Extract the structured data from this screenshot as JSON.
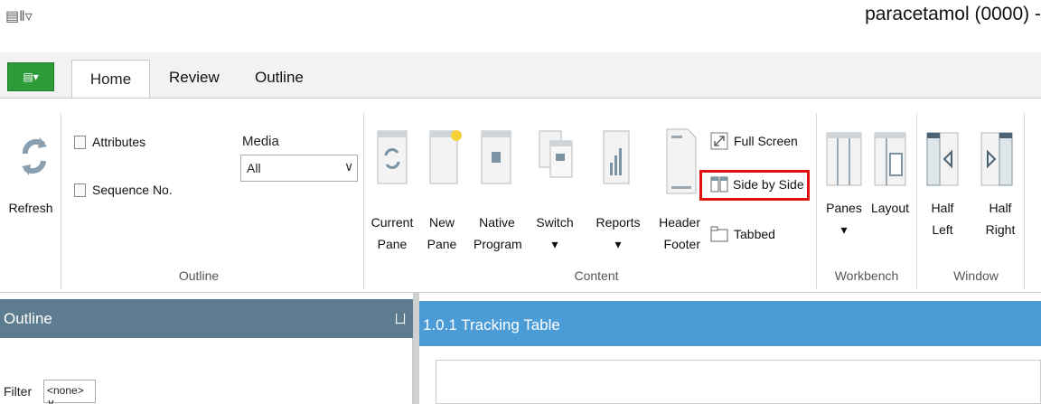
{
  "app": {
    "quick_access": "▤‖▿",
    "title": "paracetamol (0000) -"
  },
  "tabs": {
    "file_icon": "▤▾",
    "items": [
      "Home",
      "Review",
      "Outline"
    ],
    "active": "Home"
  },
  "ribbon": {
    "outline_group": {
      "label": "Outline",
      "refresh_label": "Refresh",
      "attributes_label": "Attributes",
      "sequence_label": "Sequence No.",
      "media_label": "Media",
      "media_value": "All"
    },
    "content_group": {
      "label": "Content",
      "current_pane": [
        "Current",
        "Pane"
      ],
      "new_pane": [
        "New",
        "Pane"
      ],
      "native_program": [
        "Native",
        "Program"
      ],
      "switch": [
        "Switch",
        "▾"
      ],
      "reports": [
        "Reports",
        "▾"
      ],
      "header_footer": [
        "Header",
        "Footer"
      ],
      "full_screen": "Full Screen",
      "side_by_side": "Side by Side",
      "tabbed": "Tabbed"
    },
    "workbench_group": {
      "label": "Workbench",
      "panes": [
        "Panes",
        "▾"
      ],
      "layout": "Layout"
    },
    "window_group": {
      "label": "Window",
      "half_left": [
        "Half",
        "Left"
      ],
      "half_right": [
        "Half",
        "Right"
      ]
    }
  },
  "outline_panel": {
    "title": "Outline",
    "pin": "ㄩ",
    "filter_label": "Filter",
    "filter_value": "<none> ∨"
  },
  "document_panel": {
    "title": "1.0.1 Tracking Table"
  },
  "colors": {
    "accent": "#4a9bd6",
    "outline_header": "#5d7c8f",
    "file_button": "#2e9b39",
    "highlight": "#e01010"
  }
}
